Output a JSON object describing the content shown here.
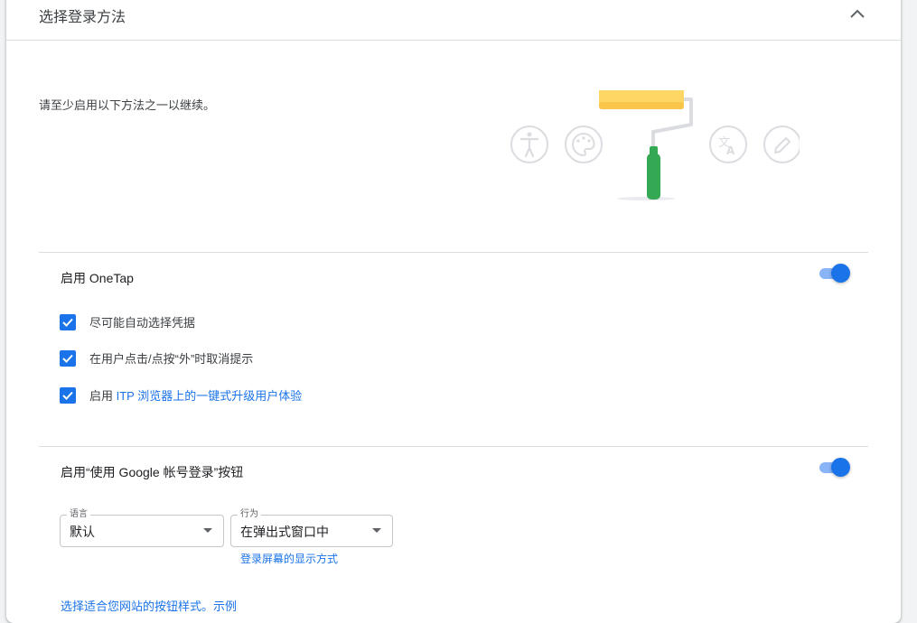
{
  "header": {
    "title": "选择登录方法"
  },
  "intro": "请至少启用以下方法之一以继续。",
  "onetap": {
    "title": "启用 OneTap",
    "toggle_on": true,
    "options": [
      {
        "label": "尽可能自动选择凭据",
        "checked": true
      },
      {
        "label": "在用户点击/点按“外”时取消提示",
        "checked": true
      },
      {
        "label_prefix": "启用 ",
        "link": "ITP 浏览器上的一键式升级用户体验",
        "checked": true
      }
    ]
  },
  "google_button": {
    "title": "启用“使用 Google 帐号登录”按钮",
    "toggle_on": true,
    "language": {
      "legend": "语言",
      "value": "默认"
    },
    "behavior": {
      "legend": "行为",
      "value": "在弹出式窗口中"
    },
    "behavior_link": "登录屏幕的显示方式",
    "style_link": "选择适合您网站的按钮样式。示例"
  },
  "colors": {
    "accent": "#1a73e8",
    "toggle_track": "#8ab4f8",
    "roller_yellow": "#fdd663",
    "handle_green": "#34a853"
  },
  "illustration_icons": [
    "accessibility-icon",
    "palette-icon",
    "translate-icon",
    "edit-pencil-icon",
    "paint-roller-icon"
  ]
}
